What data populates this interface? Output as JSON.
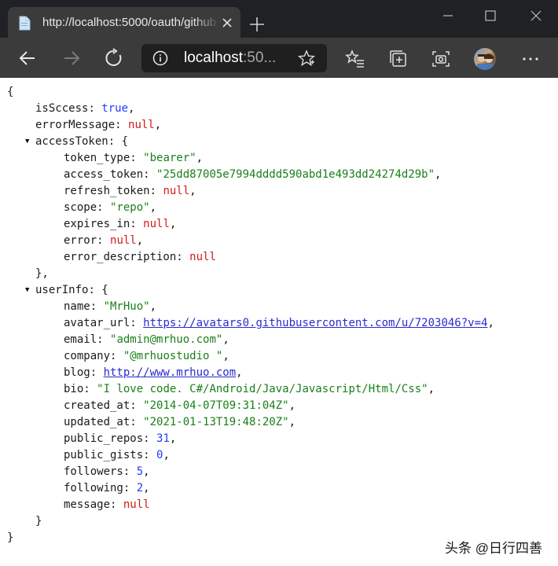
{
  "browser": {
    "tab_title": "http://localhost:5000/oauth/github",
    "address_host": "localhost",
    "address_rest": ":50...",
    "icons": [
      "page-icon",
      "close-icon",
      "plus-icon",
      "minimize-icon",
      "maximize-icon",
      "window-close-icon",
      "back-icon",
      "forward-icon",
      "refresh-icon",
      "info-icon",
      "star-outline-icon",
      "favorites-icon",
      "collections-icon",
      "screenshot-icon",
      "profile-avatar",
      "more-icon"
    ]
  },
  "json": {
    "open_brace": "{",
    "close_brace": "}",
    "isSccess": {
      "key": "isSccess",
      "value": "true"
    },
    "errorMessage": {
      "key": "errorMessage",
      "value": "null"
    },
    "accessToken": {
      "key": "accessToken",
      "token_type": {
        "key": "token_type",
        "value": "\"bearer\""
      },
      "access_token": {
        "key": "access_token",
        "value": "\"25dd87005e7994dddd590abd1e493dd24274d29b\""
      },
      "refresh_token": {
        "key": "refresh_token",
        "value": "null"
      },
      "scope": {
        "key": "scope",
        "value": "\"repo\""
      },
      "expires_in": {
        "key": "expires_in",
        "value": "null"
      },
      "error": {
        "key": "error",
        "value": "null"
      },
      "error_description": {
        "key": "error_description",
        "value": "null"
      }
    },
    "userInfo": {
      "key": "userInfo",
      "name": {
        "key": "name",
        "value": "\"MrHuo\""
      },
      "avatar_url": {
        "key": "avatar_url",
        "value": "https://avatars0.githubusercontent.com/u/7203046?v=4"
      },
      "email": {
        "key": "email",
        "value": "\"admin@mrhuo.com\""
      },
      "company": {
        "key": "company",
        "value": "\"@mrhuostudio \""
      },
      "blog": {
        "key": "blog",
        "value": "http://www.mrhuo.com"
      },
      "bio": {
        "key": "bio",
        "value": "\"I love code. C#/Android/Java/Javascript/Html/Css\""
      },
      "created_at": {
        "key": "created_at",
        "value": "\"2014-04-07T09:31:04Z\""
      },
      "updated_at": {
        "key": "updated_at",
        "value": "\"2021-01-13T19:48:20Z\""
      },
      "public_repos": {
        "key": "public_repos",
        "value": "31"
      },
      "public_gists": {
        "key": "public_gists",
        "value": "0"
      },
      "followers": {
        "key": "followers",
        "value": "5"
      },
      "following": {
        "key": "following",
        "value": "2"
      },
      "message": {
        "key": "message",
        "value": "null"
      }
    }
  },
  "watermark": "头条 @日行四善"
}
